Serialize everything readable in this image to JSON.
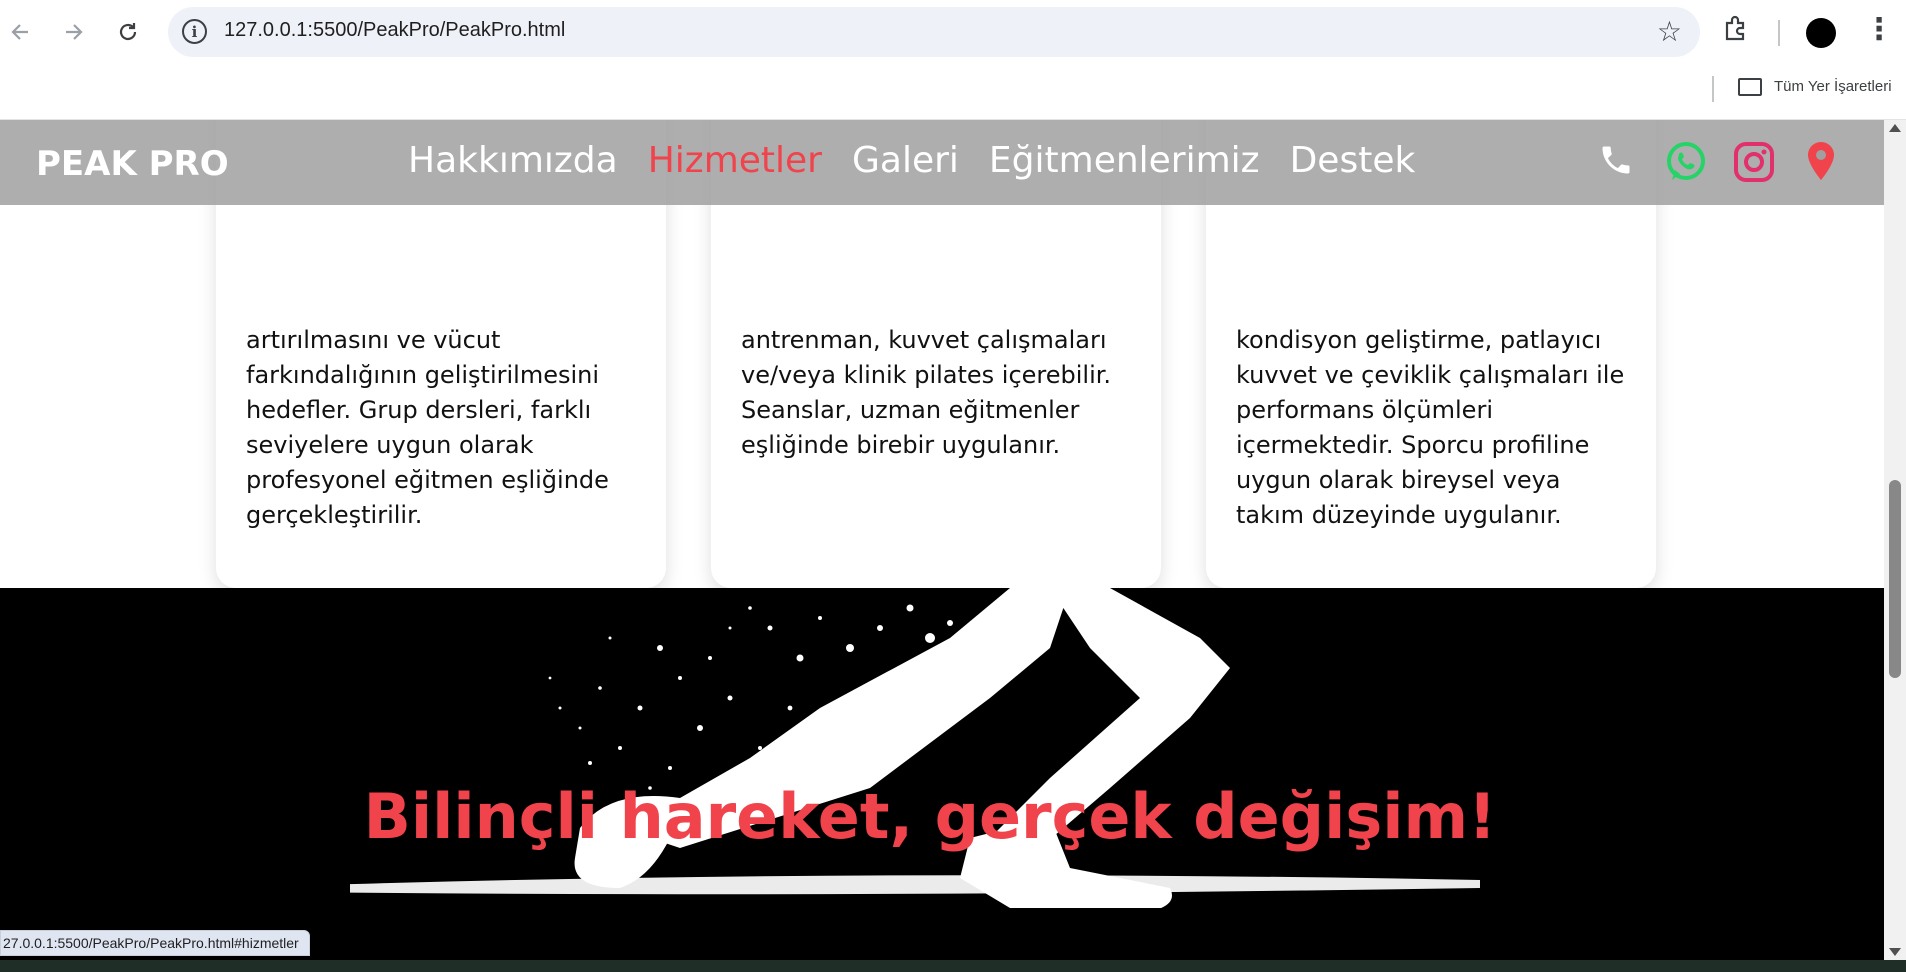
{
  "browser": {
    "url": "127.0.0.1:5500/PeakPro/PeakPro.html",
    "bookmarks_label": "Tüm Yer İşaretleri",
    "status_url": "27.0.0.1:5500/PeakPro/PeakPro.html#hizmetler"
  },
  "site": {
    "brand": "PEAK PRO",
    "nav": [
      {
        "label": "Hakkımızda",
        "active": false
      },
      {
        "label": "Hizmetler",
        "active": true
      },
      {
        "label": "Galeri",
        "active": false
      },
      {
        "label": "Eğitmenlerimiz",
        "active": false
      },
      {
        "label": "Destek",
        "active": false
      }
    ],
    "social_icons": [
      "phone-icon",
      "whatsapp-icon",
      "instagram-icon",
      "location-pin-icon"
    ],
    "colors": {
      "accent": "#f0434b",
      "whatsapp": "#25d366",
      "instagram": "#e1306c"
    }
  },
  "cards": [
    {
      "text": "artırılmasını ve vücut farkındalığının geliştirilmesini hedefler. Grup dersleri, farklı seviyelere uygun olarak profesyonel eğitmen eşliğinde gerçekleştirilir."
    },
    {
      "text": "antrenman, kuvvet çalışmaları ve/veya klinik pilates içerebilir. Seanslar, uzman eğitmenler eşliğinde birebir uygulanır."
    },
    {
      "text": "kondisyon geliştirme, patlayıcı kuvvet ve çeviklik çalışmaları ile performans ölçümleri içermektedir. Sporcu profiline uygun olarak bireysel veya takım düzeyinde uygulanır."
    }
  ],
  "hero": {
    "title": "Bilinçli hareket, gerçek değişim!"
  }
}
